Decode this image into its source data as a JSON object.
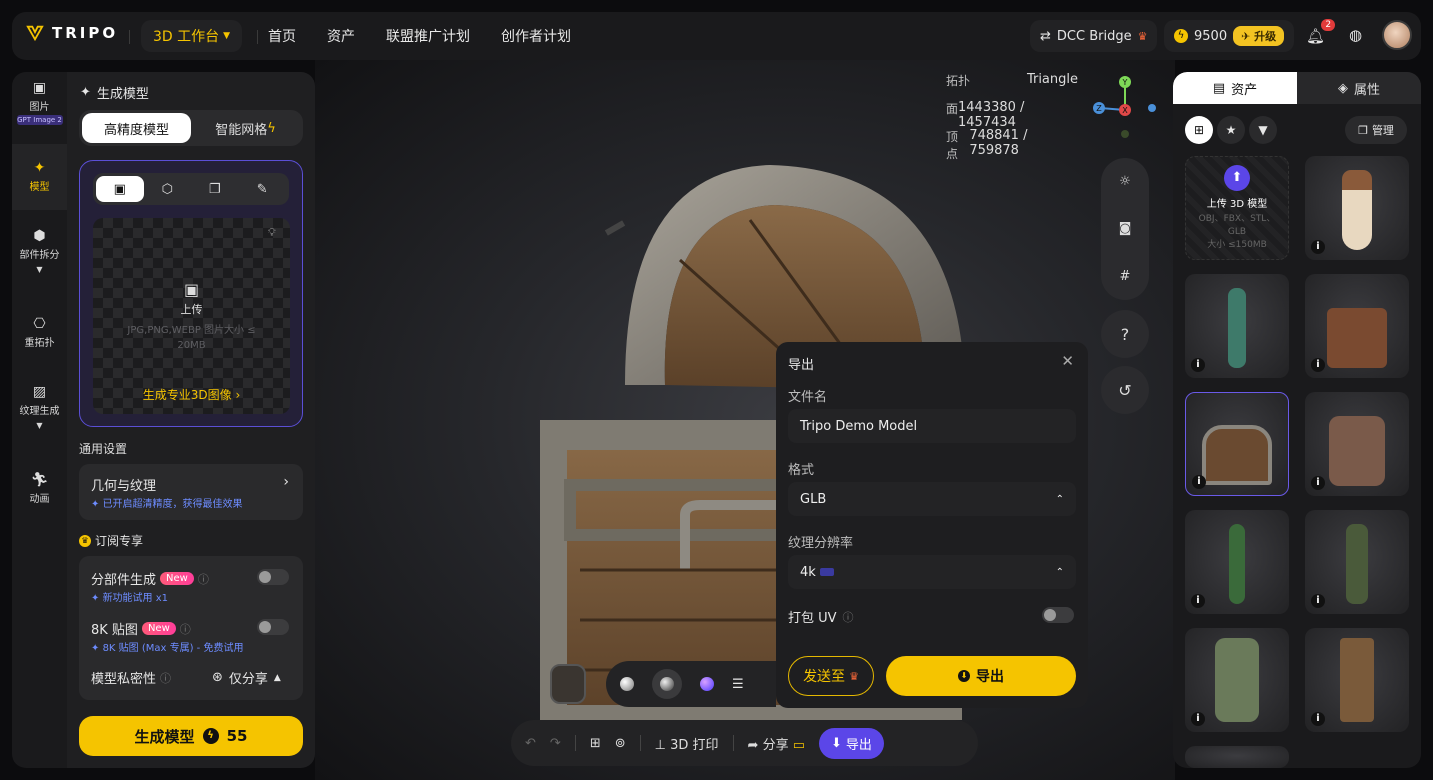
{
  "brand": {
    "name": "TRIPO",
    "accent": "#f5c400"
  },
  "workspace": {
    "label": "3D 工作台"
  },
  "nav": [
    "首页",
    "资产",
    "联盟推广计划",
    "创作者计划"
  ],
  "topright": {
    "dcc": "DCC Bridge",
    "credits": "9500",
    "upgrade": "升级",
    "notif_count": "2"
  },
  "rail": [
    {
      "label": "图片",
      "sub": "GPT Image 2",
      "icon": "image-icon"
    },
    {
      "label": "模型",
      "icon": "sparkle-icon"
    },
    {
      "label": "部件拆分",
      "icon": "cube-split-icon"
    },
    {
      "label": "重拓扑",
      "icon": "retopo-icon"
    },
    {
      "label": "纹理生成",
      "icon": "texture-icon"
    },
    {
      "label": "动画",
      "icon": "run-icon"
    }
  ],
  "panel": {
    "title": "生成模型",
    "modes": [
      "高精度模型",
      "智能网格"
    ],
    "upload": {
      "label": "上传",
      "formats": "JPG,PNG,WEBP 图片大小 ≤ 20MB",
      "gen_link": "生成专业3D图像"
    },
    "general_title": "通用设置",
    "geo": {
      "label": "几何与纹理",
      "hint": "已开启超清精度，获得最佳效果"
    },
    "sub_title": "订阅专享",
    "part": {
      "label": "分部件生成",
      "tag": "New",
      "hint": "新功能试用 x1"
    },
    "tex8k": {
      "label": "8K 贴图",
      "tag": "New",
      "hint": "8K 贴图 (Max 专属) - 免费试用"
    },
    "privacy": {
      "label": "模型私密性",
      "value": "仅分享"
    },
    "generate": {
      "label": "生成模型",
      "cost": "55"
    }
  },
  "stats": {
    "topo_k": "拓扑",
    "topo_v": "Triangle",
    "face_k": "面",
    "face_v": "1443380 / 1457434",
    "vert_k": "顶点",
    "vert_v": "748841 / 759878"
  },
  "export": {
    "title": "导出",
    "filename_label": "文件名",
    "filename": "Tripo Demo Model",
    "format_label": "格式",
    "format": "GLB",
    "res_label": "纹理分辨率",
    "res": "4k",
    "uv_label": "打包 UV",
    "send": "发送至",
    "export": "导出"
  },
  "bottom": {
    "print": "3D 打印",
    "share": "分享",
    "export": "导出"
  },
  "assets": {
    "tab_assets": "资产",
    "tab_props": "属性",
    "manage": "管理",
    "upload_title": "上传 3D 模型",
    "upload_formats": "OBJ、FBX、STL、GLB",
    "upload_size": "大小 ≤150MB"
  }
}
